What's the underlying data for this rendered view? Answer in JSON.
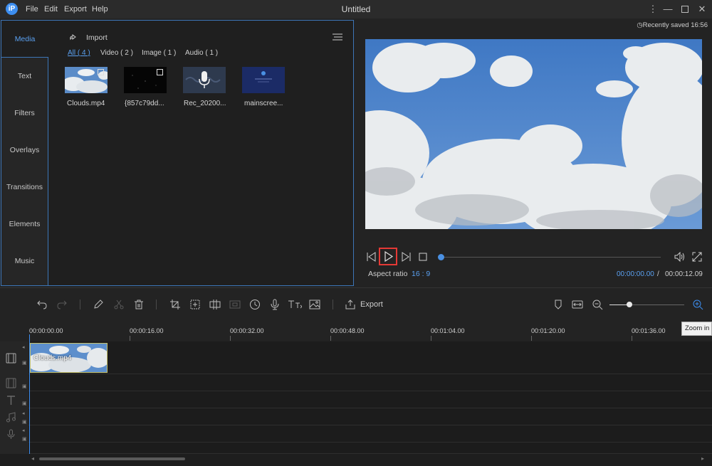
{
  "app": {
    "logo_text": "iP",
    "title": "Untitled"
  },
  "menu": {
    "file": "File",
    "edit": "Edit",
    "export": "Export",
    "help": "Help"
  },
  "sidebar": {
    "items": [
      {
        "label": "Media",
        "active": true
      },
      {
        "label": "Text"
      },
      {
        "label": "Filters"
      },
      {
        "label": "Overlays"
      },
      {
        "label": "Transitions"
      },
      {
        "label": "Elements"
      },
      {
        "label": "Music"
      }
    ]
  },
  "media": {
    "import_label": "Import",
    "filters": [
      "All ( 4 )",
      "Video ( 2 )",
      "Image ( 1 )",
      "Audio ( 1 )"
    ],
    "items": [
      {
        "name": "Clouds.mp4",
        "icon": "video-thumbnail"
      },
      {
        "name": "{857c79dd...",
        "icon": "video-thumbnail"
      },
      {
        "name": "Rec_20200...",
        "icon": "microphone-icon"
      },
      {
        "name": "mainscree...",
        "icon": "image-thumbnail"
      }
    ]
  },
  "preview": {
    "saved_text": "Recently saved 16:56",
    "aspect_label": "Aspect ratio",
    "aspect_value": "16 : 9",
    "time_current": "00:00:00.00",
    "time_sep": "/",
    "time_total": "00:00:12.09",
    "progress": 0
  },
  "toolbar": {
    "export_label": "Export",
    "tooltip": "Zoom in"
  },
  "timeline": {
    "ticks": [
      "00:00:00.00",
      "00:00:16.00",
      "00:00:32.00",
      "00:00:48.00",
      "00:01:04.00",
      "00:01:20.00",
      "00:01:36.00"
    ],
    "clip_label": "Clouds.mp4"
  },
  "colors": {
    "accent": "#3d8ef0",
    "highlight": "#e53935",
    "clip_border": "#c6c16c"
  }
}
